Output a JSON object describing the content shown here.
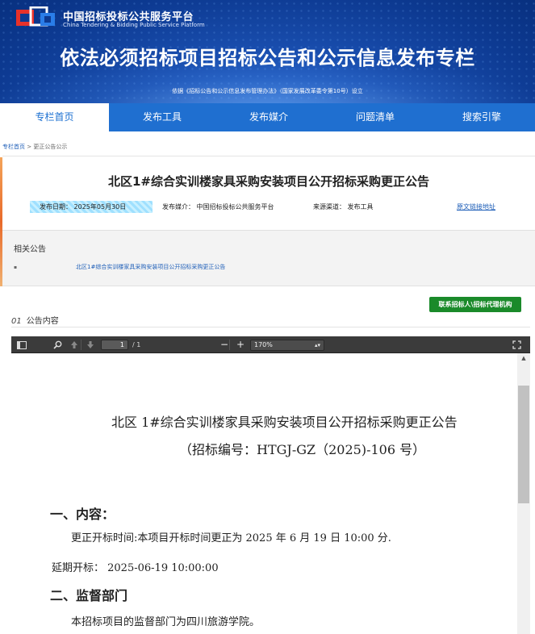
{
  "header": {
    "logo_cn": "中国招标投标公共服务平台",
    "logo_en": "China Tendering & Bidding Public Service Platform",
    "title": "依法必须招标项目招标公告和公示信息发布专栏",
    "subtitle": "依据《招标公告和公示信息发布管理办法》（国家发展改革委令第10号）设立"
  },
  "nav": {
    "items": [
      {
        "label": "专栏首页"
      },
      {
        "label": "发布工具"
      },
      {
        "label": "发布媒介"
      },
      {
        "label": "问题清单"
      },
      {
        "label": "搜索引擎"
      }
    ]
  },
  "breadcrumb": {
    "home": "专栏首页",
    "sep": " > ",
    "current": "更正公告公示"
  },
  "notice": {
    "title": "北区1#综合实训楼家具采购安装项目公开招标采购更正公告",
    "publish_date": "发布日期：   2025年05月30日",
    "media": "发布媒介：  中国招标投标公共服务平台",
    "source": "来源渠道：  发布工具",
    "original_link": "原文链接地址"
  },
  "related": {
    "title": "相关公告",
    "bullet": "▪",
    "item": "北区1#综合实训楼家具采购安装项目公开招标采购更正公告"
  },
  "content_section": {
    "number": "01",
    "label": "公告内容",
    "contact_button": "联系招标人\\招标代理机构"
  },
  "pdf_viewer": {
    "page_current": "1",
    "page_total": "/ 1",
    "zoom": "170%",
    "icons": [
      "sidebar-toggle-icon",
      "search-icon",
      "prev-page-icon",
      "next-page-icon",
      "zoom-out-icon",
      "zoom-in-icon",
      "fullscreen-icon"
    ],
    "doc": {
      "title": "北区 1#综合实训楼家具采购安装项目公开招标采购更正公告",
      "code": "（招标编号：HTGJ-GZ（2025)-106 号）",
      "h1": "一、内容：",
      "line1": "更正开标时间:本项目开标时间更正为 2025 年 6 月 19 日 10:00 分.",
      "line2": "延期开标：  2025-06-19  10:00:00",
      "h2": "二、监督部门",
      "line3": "本招标项目的监督部门为四川旅游学院。"
    }
  },
  "colors": {
    "nav_bg": "#1f6fd0",
    "banner_bg": "#0d3a92",
    "link": "#1f5fb8",
    "contact_button": "#1a8a2a",
    "toolbar": "#3b3b3b"
  }
}
